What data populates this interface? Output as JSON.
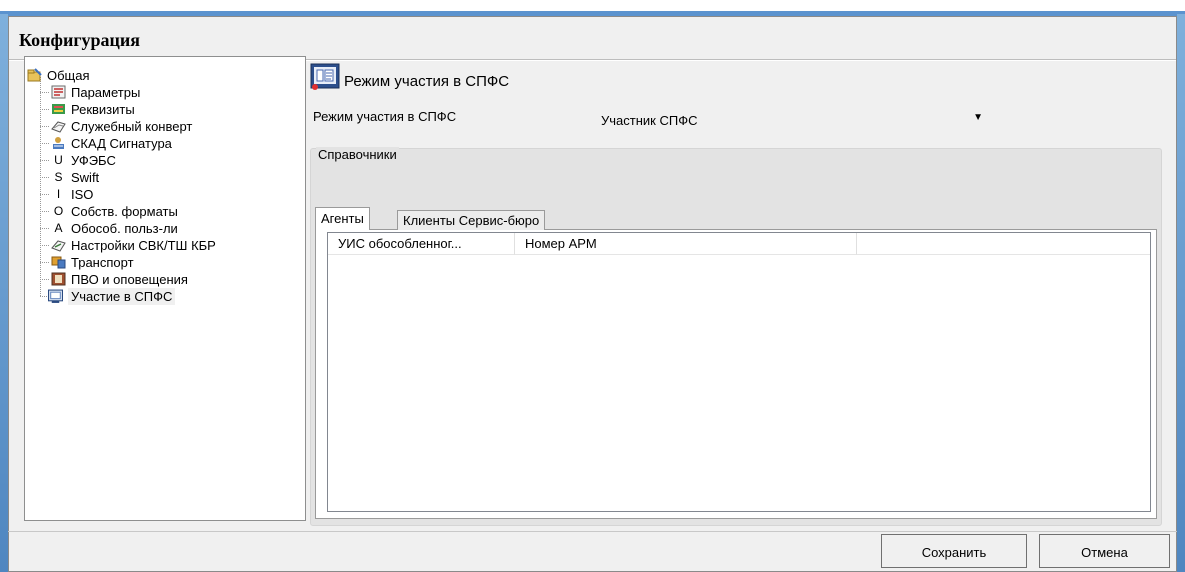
{
  "window": {
    "title": "Конфигурация"
  },
  "tree": {
    "root": {
      "label": "Общая",
      "icon": "folder-settings-icon"
    },
    "items": [
      {
        "label": "Параметры",
        "icon": "parameters-icon",
        "glyph": ""
      },
      {
        "label": "Реквизиты",
        "icon": "requisites-icon",
        "glyph": ""
      },
      {
        "label": "Служебный конверт",
        "icon": "envelope-icon",
        "glyph": ""
      },
      {
        "label": "СКАД Сигнатура",
        "icon": "signature-icon",
        "glyph": ""
      },
      {
        "label": "УФЭБС",
        "icon": "letter-u-icon",
        "glyph": "U"
      },
      {
        "label": "Swift",
        "icon": "letter-s-icon",
        "glyph": "S"
      },
      {
        "label": "ISO",
        "icon": "letter-i-icon",
        "glyph": "I"
      },
      {
        "label": "Собств. форматы",
        "icon": "letter-o-icon",
        "glyph": "O"
      },
      {
        "label": "Обособ. польз-ли",
        "icon": "letter-a-icon",
        "glyph": "A"
      },
      {
        "label": "Настройки СВК/ТШ КБР",
        "icon": "settings-arrows-icon",
        "glyph": ""
      },
      {
        "label": "Транспорт",
        "icon": "transport-icon",
        "glyph": ""
      },
      {
        "label": "ПВО и оповещения",
        "icon": "notifications-icon",
        "glyph": ""
      },
      {
        "label": "Участие в СПФС",
        "icon": "spfs-icon",
        "glyph": ""
      }
    ]
  },
  "panel": {
    "header": "Режим участия в СПФС",
    "mode_label": "Режим участия в СПФС",
    "mode_value": "Участник СПФС",
    "group_label": "Справочники",
    "tabs": [
      "Агенты",
      "Клиенты Сервис-бюро"
    ],
    "columns": [
      "УИС обособленног...",
      "Номер АРМ"
    ]
  },
  "buttons": {
    "save": "Сохранить",
    "cancel": "Отмена"
  }
}
